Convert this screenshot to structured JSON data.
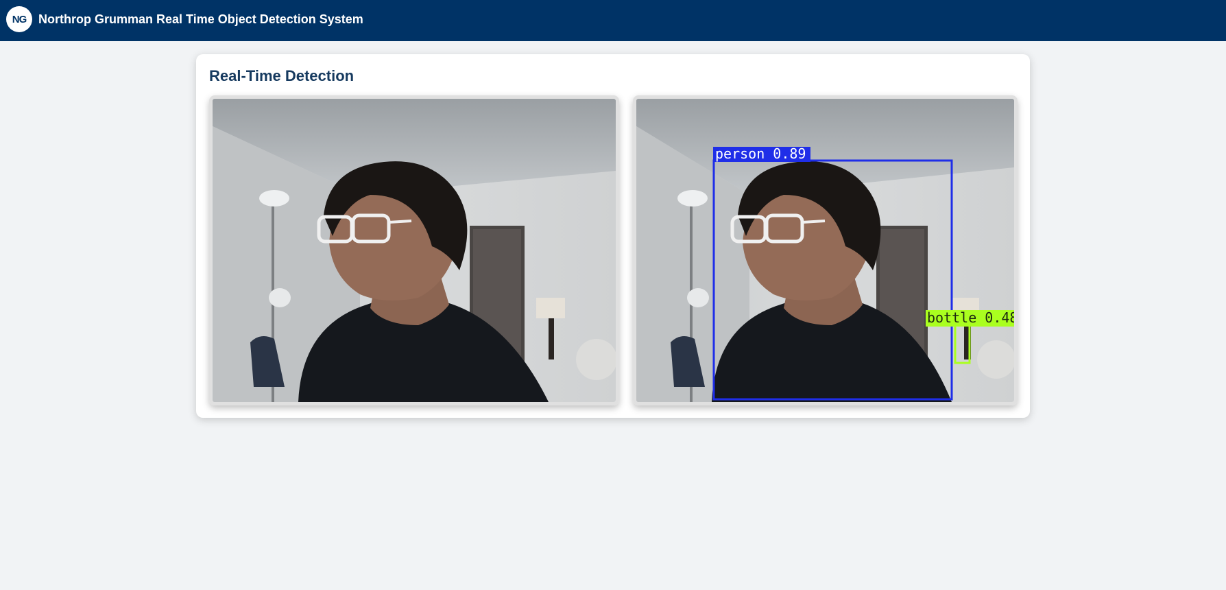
{
  "header": {
    "logo_text": "NG",
    "title": "Northrop Grumman Real Time Object Detection System"
  },
  "main": {
    "title": "Real-Time Detection",
    "detections": [
      {
        "label": "person 0.89",
        "color": "#1f2ee8"
      },
      {
        "label": "bottle 0.48",
        "color": "#aaff1f"
      }
    ]
  },
  "colors": {
    "header_bg": "#003366",
    "page_bg": "#f1f3f5",
    "title_color": "#163a5f"
  }
}
